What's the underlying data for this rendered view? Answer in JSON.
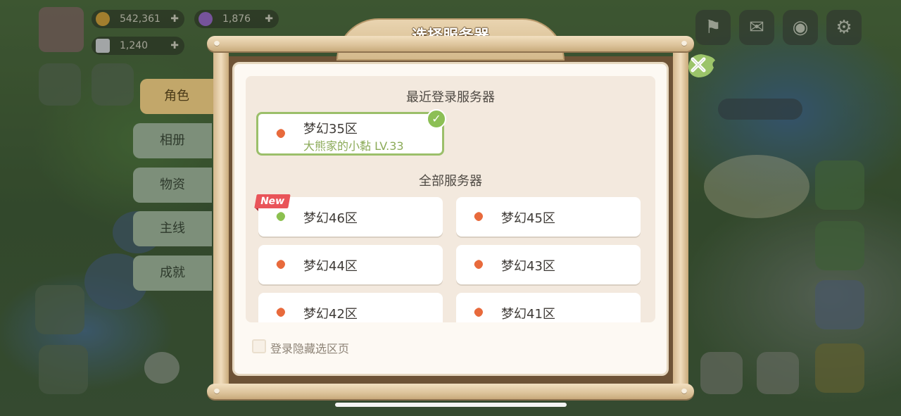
{
  "hud": {
    "gold_value": "542,361",
    "gem_value": "1,876",
    "ticket_value": "1,240"
  },
  "dialog": {
    "title": "选择服务器",
    "recent_section_title": "最近登录服务器",
    "all_section_title": "全部服务器",
    "recent_server": {
      "name": "梦幻35区",
      "character": "大熊家的小黏  LV.33",
      "status_color": "#e86a3c"
    },
    "servers": [
      {
        "name": "梦幻46区",
        "badge": "New",
        "status_color": "#8cc04f"
      },
      {
        "name": "梦幻45区",
        "badge": "",
        "status_color": "#e86a3c"
      },
      {
        "name": "梦幻44区",
        "badge": "",
        "status_color": "#e86a3c"
      },
      {
        "name": "梦幻43区",
        "badge": "",
        "status_color": "#e86a3c"
      },
      {
        "name": "梦幻42区",
        "badge": "",
        "status_color": "#e86a3c"
      },
      {
        "name": "梦幻41区",
        "badge": "",
        "status_color": "#e86a3c"
      }
    ],
    "hide_checkbox_label": "登录隐藏选区页",
    "hide_checkbox_checked": false
  },
  "side_tabs": [
    {
      "label": "角色",
      "active": true
    },
    {
      "label": "相册",
      "active": false
    },
    {
      "label": "物资",
      "active": false
    },
    {
      "label": "主线",
      "active": false
    },
    {
      "label": "成就",
      "active": false
    }
  ],
  "colors": {
    "accent_green": "#8cbf55",
    "new_badge": "#e95459",
    "frame_wood": "#dcc39a"
  }
}
